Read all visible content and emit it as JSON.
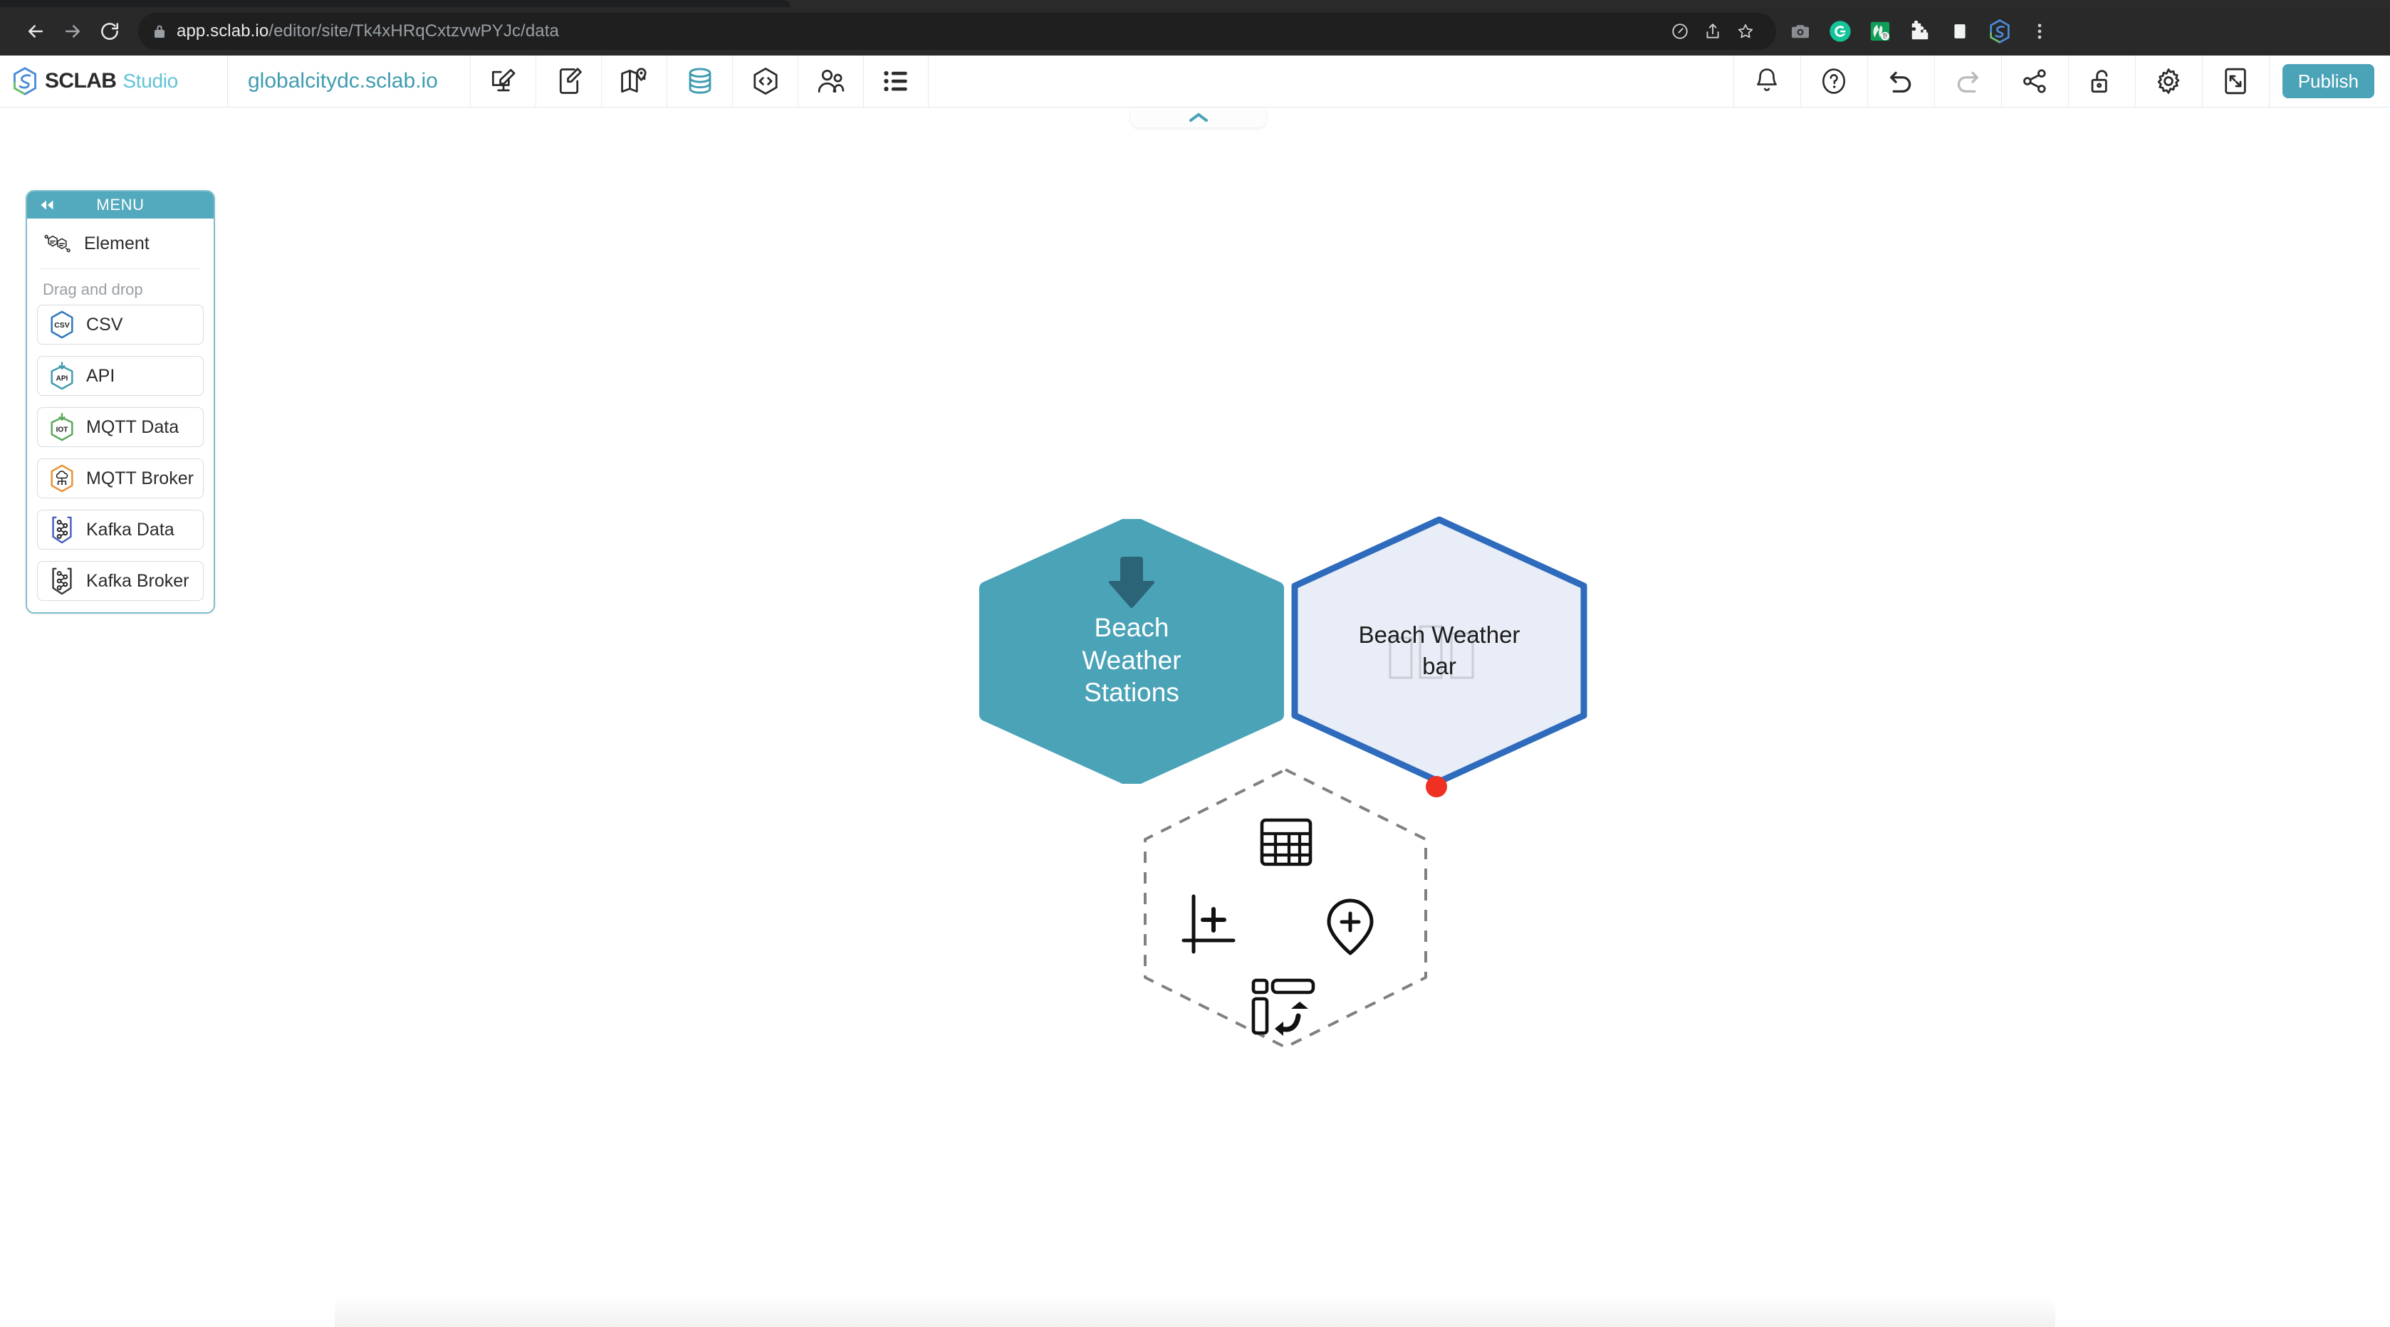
{
  "browser": {
    "url_bold": "app.sclab.io",
    "url_dim": "/editor/site/Tk4xHRqCxtzvwPYJc/data",
    "nav": {
      "back": "back-arrow",
      "forward": "forward-arrow",
      "reload": "reload-icon",
      "lock": "lock-icon"
    },
    "omni_icons": [
      "speedometer-icon",
      "share-icon",
      "bookmark-star-icon"
    ],
    "extensions": [
      {
        "name": "screenshot-camera-icon",
        "color": "#8a8d91"
      },
      {
        "name": "grammarly-icon",
        "color": "#15c39a"
      },
      {
        "name": "korean-translate-icon",
        "color": "#0f9d58"
      },
      {
        "name": "puzzle-extensions-icon",
        "color": "#ffffff"
      },
      {
        "name": "sidepanel-icon",
        "color": "#ffffff"
      },
      {
        "name": "sclab-extension-icon",
        "color": "#4c8dd9"
      },
      {
        "name": "browser-menu-icon",
        "color": "#cfd2d5"
      }
    ]
  },
  "header": {
    "brand_name": "SCLAB",
    "brand_sub": "Studio",
    "site_name": "globalcitydc.sclab.io",
    "center_tools": [
      {
        "name": "desktop-edit-icon",
        "label": "Desktop Editor",
        "active": false
      },
      {
        "name": "mobile-edit-icon",
        "label": "Mobile Editor",
        "active": false
      },
      {
        "name": "map-icon",
        "label": "Map",
        "active": false
      },
      {
        "name": "database-icon",
        "label": "Data",
        "active": true
      },
      {
        "name": "code-hexagon-icon",
        "label": "Code",
        "active": false
      },
      {
        "name": "users-icon",
        "label": "Members",
        "active": false
      },
      {
        "name": "list-icon",
        "label": "List",
        "active": false
      }
    ],
    "right_tools": [
      {
        "name": "bell-icon",
        "label": "Notifications",
        "disabled": false
      },
      {
        "name": "help-circle-icon",
        "label": "Help",
        "disabled": false
      },
      {
        "name": "undo-icon",
        "label": "Undo",
        "disabled": false
      },
      {
        "name": "redo-icon",
        "label": "Redo",
        "disabled": true
      },
      {
        "name": "share-nodes-icon",
        "label": "Share",
        "disabled": false
      },
      {
        "name": "unlock-icon",
        "label": "Unlock",
        "disabled": false
      },
      {
        "name": "gear-icon",
        "label": "Settings",
        "disabled": false
      },
      {
        "name": "fullscreen-icon",
        "label": "Fullscreen",
        "disabled": false
      }
    ],
    "publish_label": "Publish",
    "accent_teal": "#4ba3b8"
  },
  "sidebar": {
    "title": "MENU",
    "collapse_icon": "double-chevron-left-icon",
    "element": {
      "label": "Element",
      "icon": "element-molecule-icon"
    },
    "drag_hint": "Drag and drop",
    "drag_items": [
      {
        "label": "CSV",
        "icon": "csv-hexagon-icon",
        "color": "#2e76bd"
      },
      {
        "label": "API",
        "icon": "api-hexagon-icon",
        "color": "#3f9cb0"
      },
      {
        "label": "MQTT Data",
        "icon": "iot-hexagon-icon",
        "color": "#5aa85a"
      },
      {
        "label": "MQTT Broker",
        "icon": "mqtt-broker-hexagon-icon",
        "color": "#e8923a"
      },
      {
        "label": "Kafka Data",
        "icon": "kafka-data-hexagon-icon",
        "color": "#4a5fc1"
      },
      {
        "label": "Kafka Broker",
        "icon": "kafka-broker-hexagon-icon",
        "color": "#3c3c3c"
      }
    ]
  },
  "canvas": {
    "top_collapse_icon": "chevron-up-icon",
    "nodes": [
      {
        "id": "source",
        "label_lines": [
          "Beach",
          "Weather",
          "Stations"
        ],
        "type": "data-source-hexagon",
        "fill": "#4ba3b8",
        "icon": "download-arrow-icon"
      },
      {
        "id": "chart",
        "label_lines": [
          "Beach Weather",
          "bar"
        ],
        "type": "chart-element-hexagon",
        "fill": "#e8edf7",
        "border": "#2e6bbd",
        "watermark": "bar-chart-watermark",
        "status_dot_color": "#ef3124"
      },
      {
        "id": "add",
        "type": "add-placeholder-hexagon",
        "icons": [
          {
            "name": "add-table-icon"
          },
          {
            "name": "add-axis-chart-icon"
          },
          {
            "name": "add-map-pin-icon"
          },
          {
            "name": "add-flow-chart-icon"
          }
        ]
      }
    ]
  }
}
